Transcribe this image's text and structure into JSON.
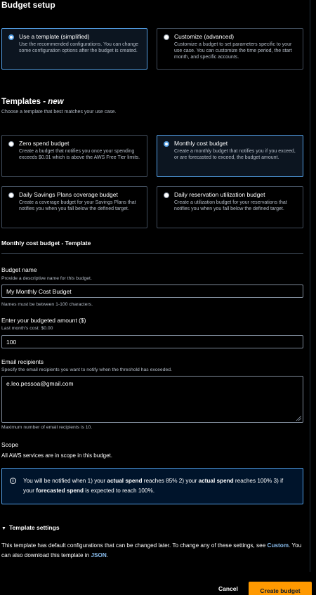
{
  "budget_setup": {
    "title": "Budget setup",
    "options": [
      {
        "title": "Use a template (simplified)",
        "desc": "Use the recommended configurations. You can change some configuration options after the budget is created.",
        "selected": true
      },
      {
        "title": "Customize (advanced)",
        "desc": "Customize a budget to set parameters specific to your use case. You can customize the time period, the start month, and specific accounts.",
        "selected": false
      }
    ]
  },
  "templates": {
    "title": "Templates - ",
    "title_badge": "new",
    "subtitle": "Choose a template that best matches your use case.",
    "options": [
      {
        "title": "Zero spend budget",
        "desc": "Create a budget that notifies you once your spending exceeds $0.01 which is above the AWS Free Tier limits.",
        "selected": false
      },
      {
        "title": "Monthly cost budget",
        "desc": "Create a monthly budget that notifies you if you exceed, or are forecasted to exceed, the budget amount.",
        "selected": true
      },
      {
        "title": "Daily Savings Plans coverage budget",
        "desc": "Create a coverage budget for your Savings Plans that notifies you when you fall below the defined target.",
        "selected": false
      },
      {
        "title": "Daily reservation utilization budget",
        "desc": "Create a utilization budget for your reservations that notifies you when you fall below the defined target.",
        "selected": false
      }
    ]
  },
  "template_form": {
    "title": "Monthly cost budget - Template",
    "budget_name": {
      "label": "Budget name",
      "description": "Provide a descriptive name for this budget.",
      "value": "My Monthly Cost Budget",
      "constraint": "Names must be between 1-100 characters."
    },
    "amount": {
      "label": "Enter your budgeted amount ($)",
      "description": "Last month's cost: $0.00",
      "value": "100"
    },
    "email": {
      "label": "Email recipients",
      "description": "Specify the email recipients you want to notify when the threshold has exceeded.",
      "value": "e.leo.pessoa@gmail.com",
      "constraint": "Maximum number of email recipients is 10."
    },
    "scope": {
      "label": "Scope",
      "text": "All AWS services are in scope in this budget."
    }
  },
  "info": {
    "p1": "You will be notified when 1) your ",
    "b1": "actual spend",
    "p2": " reaches 85% 2) your ",
    "b2": "actual spend",
    "p3": " reaches 100% 3) if your ",
    "b3": "forecasted spend",
    "p4": " is expected to reach 100%."
  },
  "template_settings": {
    "title": "Template settings",
    "text1": "This template has default configurations that can be changed later. To change any of these settings, see ",
    "link1": "Custom",
    "text2": ". You can also download this template in ",
    "link2": "JSON",
    "text3": "."
  },
  "footer": {
    "cancel_label": "Cancel",
    "create_label": "Create budget"
  },
  "colors": {
    "accent_blue": "#539fe5",
    "primary_orange": "#ff9900",
    "link": "#89bdee"
  }
}
